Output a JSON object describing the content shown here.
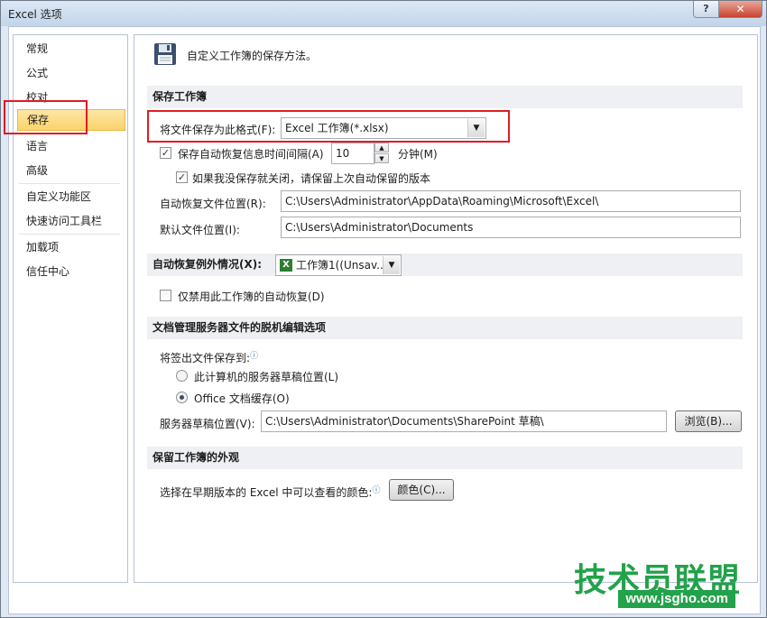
{
  "window": {
    "title": "Excel 选项",
    "help": "?",
    "close": "✕"
  },
  "nav": {
    "items": [
      {
        "label": "常规"
      },
      {
        "label": "公式"
      },
      {
        "label": "校对"
      },
      {
        "label": "保存",
        "selected": true
      },
      {
        "label": "语言"
      },
      {
        "label": "高级"
      },
      {
        "label": "自定义功能区"
      },
      {
        "label": "快速访问工具栏"
      },
      {
        "label": "加载项"
      },
      {
        "label": "信任中心"
      }
    ]
  },
  "content": {
    "intro": "自定义工作簿的保存方法。",
    "save_section": {
      "header": "保存工作簿",
      "format_label": "将文件保存为此格式(F):",
      "format_value": "Excel 工作簿(*.xlsx)",
      "autorecover_checkbox": {
        "label": "保存自动恢复信息时间间隔(A)",
        "checked": true
      },
      "autorecover_minutes": "10",
      "minutes_label": "分钟(M)",
      "keep_version_checkbox": {
        "label": "如果我没保存就关闭，请保留上次自动保留的版本",
        "checked": true
      },
      "autorecover_location_label": "自动恢复文件位置(R):",
      "autorecover_location_value": "C:\\Users\\Administrator\\AppData\\Roaming\\Microsoft\\Excel\\",
      "default_location_label": "默认文件位置(I):",
      "default_location_value": "C:\\Users\\Administrator\\Documents"
    },
    "exceptions_section": {
      "header": "自动恢复例外情况(X):",
      "workbook_value": "工作簿1((Unsav...",
      "disable_checkbox": {
        "label": "仅禁用此工作簿的自动恢复(D)",
        "checked": false
      }
    },
    "offline_section": {
      "header": "文档管理服务器文件的脱机编辑选项",
      "checkout_label": "将签出文件保存到:",
      "radio_server_drafts": {
        "label": "此计算机的服务器草稿位置(L)",
        "selected": false
      },
      "radio_office_cache": {
        "label": "Office 文档缓存(O)",
        "selected": true
      },
      "drafts_location_label": "服务器草稿位置(V):",
      "drafts_location_value": "C:\\Users\\Administrator\\Documents\\SharePoint 草稿\\",
      "browse_button": "浏览(B)..."
    },
    "appearance_section": {
      "header": "保留工作簿的外观",
      "colors_label": "选择在早期版本的 Excel 中可以查看的颜色:",
      "colors_button": "颜色(C)..."
    }
  },
  "watermark": {
    "title": "技术员联盟",
    "url": "www.jsgho.com"
  },
  "colors": {
    "accent_red": "#e01b24",
    "selection": "#fbd36a",
    "watermark": "#22a24a"
  }
}
